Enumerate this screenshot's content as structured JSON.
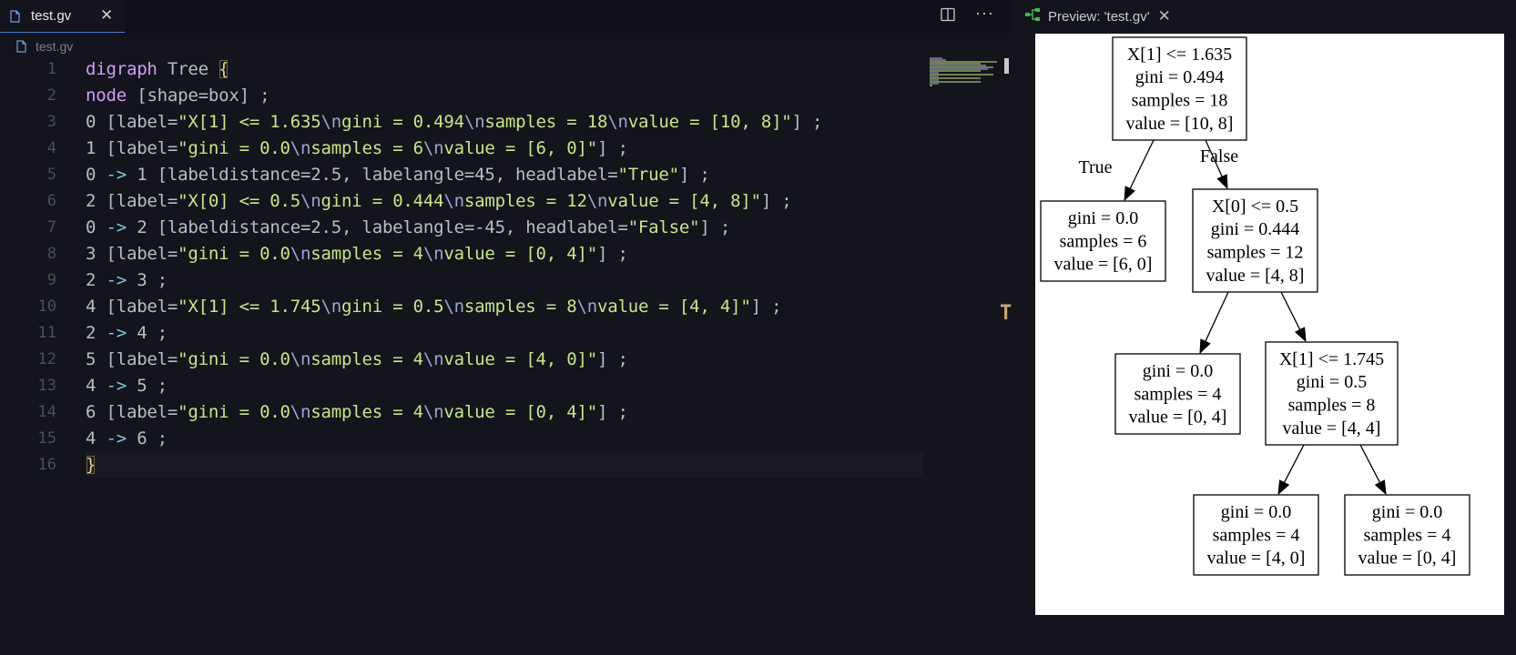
{
  "editor": {
    "tab_title": "test.gv",
    "tab_close": "✕",
    "more_actions": "···",
    "breadcrumb": "test.gv",
    "line_numbers": [
      "1",
      "2",
      "3",
      "4",
      "5",
      "6",
      "7",
      "8",
      "9",
      "10",
      "11",
      "12",
      "13",
      "14",
      "15",
      "16"
    ]
  },
  "preview": {
    "title": "Preview: 'test.gv'",
    "close": "✕"
  },
  "graph": {
    "nodes": [
      {
        "id": "0",
        "lines": [
          "X[1] <= 1.635",
          "gini = 0.494",
          "samples = 18",
          "value = [10, 8]"
        ]
      },
      {
        "id": "1",
        "lines": [
          "gini = 0.0",
          "samples = 6",
          "value = [6, 0]"
        ]
      },
      {
        "id": "2",
        "lines": [
          "X[0] <= 0.5",
          "gini = 0.444",
          "samples = 12",
          "value = [4, 8]"
        ]
      },
      {
        "id": "3",
        "lines": [
          "gini = 0.0",
          "samples = 4",
          "value = [0, 4]"
        ]
      },
      {
        "id": "4",
        "lines": [
          "X[1] <= 1.745",
          "gini = 0.5",
          "samples = 8",
          "value = [4, 4]"
        ]
      },
      {
        "id": "5",
        "lines": [
          "gini = 0.0",
          "samples = 4",
          "value = [4, 0]"
        ]
      },
      {
        "id": "6",
        "lines": [
          "gini = 0.0",
          "samples = 4",
          "value = [0, 4]"
        ]
      }
    ],
    "edges": [
      {
        "from": "0",
        "to": "1",
        "label": "True"
      },
      {
        "from": "0",
        "to": "2",
        "label": "False"
      },
      {
        "from": "2",
        "to": "3",
        "label": ""
      },
      {
        "from": "2",
        "to": "4",
        "label": ""
      },
      {
        "from": "4",
        "to": "5",
        "label": ""
      },
      {
        "from": "4",
        "to": "6",
        "label": ""
      }
    ]
  }
}
